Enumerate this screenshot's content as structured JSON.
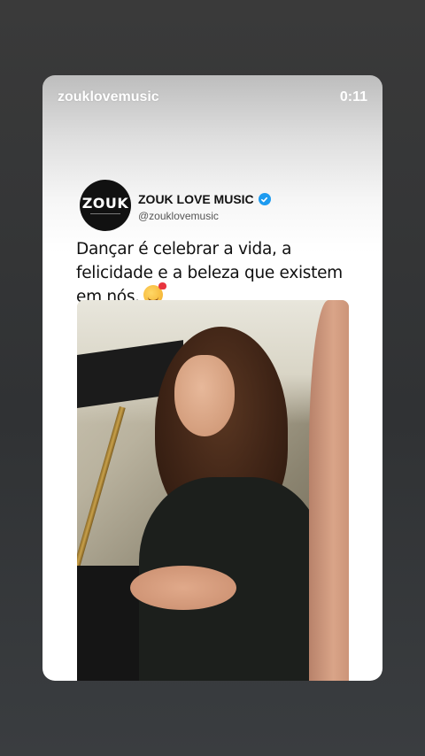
{
  "story": {
    "username": "zouklovemusic",
    "timestamp": "0:11"
  },
  "post": {
    "avatar_logo": "ZOUK",
    "account_name": "ZOUK LOVE MUSIC",
    "handle": "@zouklovemusic",
    "verified": true,
    "text": "Dançar é celebrar a vida, a felicidade e a beleza que existem em nós.",
    "emoji_icon": "smiling-face-with-hearts"
  },
  "colors": {
    "verified_badge": "#1d9bf0",
    "background": "#333333"
  }
}
